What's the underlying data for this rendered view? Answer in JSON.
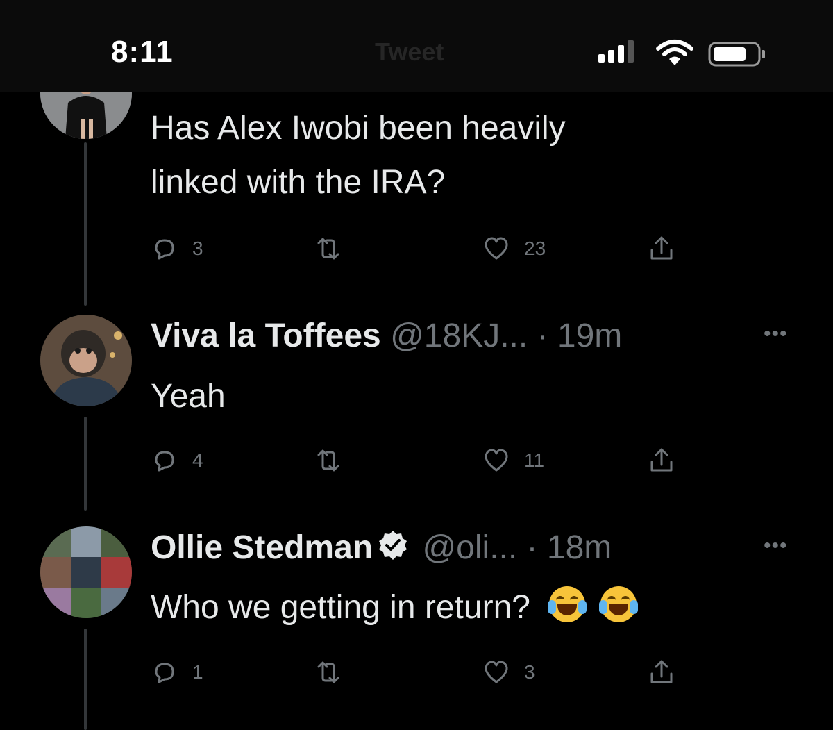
{
  "status_bar": {
    "time": "8:11",
    "header_title": "Tweet"
  },
  "tweets": [
    {
      "text_lines": [
        "Has Alex Iwobi been heavily",
        "linked with the IRA?"
      ],
      "actions": {
        "replies": "3",
        "retweets": "",
        "likes": "23"
      }
    },
    {
      "name": "Viva la Toffees",
      "handle": "@18KJ...",
      "time": "· 19m",
      "text": "Yeah",
      "actions": {
        "replies": "4",
        "retweets": "",
        "likes": "11"
      }
    },
    {
      "name": "Ollie Stedman",
      "handle": "@oli...",
      "time": "· 18m",
      "verified": true,
      "text": "Who we getting in return?",
      "emoji": "face-with-tears-of-joy",
      "actions": {
        "replies": "1",
        "retweets": "",
        "likes": "3"
      }
    }
  ],
  "icons": [
    "reply-icon",
    "retweet-icon",
    "like-icon",
    "share-icon",
    "more-icon",
    "verified-icon"
  ],
  "colors": {
    "background": "#000000",
    "text": "#e7e9ea",
    "secondary": "#71767b",
    "thread_line": "#333639"
  }
}
